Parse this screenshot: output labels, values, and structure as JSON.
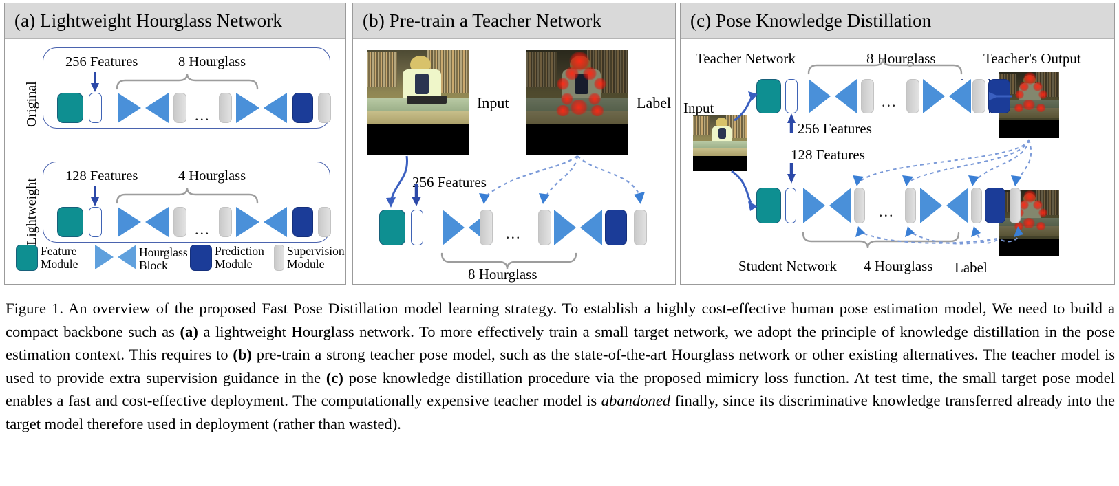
{
  "panels": [
    {
      "id": "a",
      "title": "(a) Lightweight Hourglass Network",
      "rows": [
        {
          "side_label": "Original",
          "features_label": "256 Features",
          "hourglass_label": "8 Hourglass",
          "dots": "..."
        },
        {
          "side_label": "Lightweight",
          "features_label": "128 Features",
          "hourglass_label": "4 Hourglass",
          "dots": "..."
        }
      ],
      "legend": [
        {
          "icon": "feature-module-swatch",
          "line1": "Feature",
          "line2": "Module"
        },
        {
          "icon": "hourglass-block-swatch",
          "line1": "Hourglass",
          "line2": "Block"
        },
        {
          "icon": "prediction-module-swatch",
          "line1": "Prediction",
          "line2": "Module"
        },
        {
          "icon": "supervision-module-swatch",
          "line1": "Supervision",
          "line2": "Module"
        }
      ]
    },
    {
      "id": "b",
      "title": "(b) Pre-train a Teacher Network",
      "input_label": "Input",
      "label_label": "Label",
      "features_label": "256 Features",
      "hourglass_label": "8 Hourglass",
      "dots": "..."
    },
    {
      "id": "c",
      "title": "(c) Pose Knowledge Distillation",
      "teacher_network_label": "Teacher Network",
      "teacher_hourglass_label": "8 Hourglass",
      "teacher_output_label": "Teacher's Output",
      "input_label": "Input",
      "teacher_features_label": "256 Features",
      "student_features_label": "128 Features",
      "student_network_label": "Student Network",
      "student_hourglass_label": "4 Hourglass",
      "label_label": "Label",
      "dots": "..."
    }
  ],
  "colors": {
    "feature_module": "#0e8f91",
    "hourglass_block": "#4a90d9",
    "prediction_module": "#1b3c98",
    "supervision_module": "#d0d0d0",
    "panel_header": "#d9d9d9",
    "solid_arrow": "#3a5fc0",
    "dashed_arrow": "#7b9ad8",
    "brace": "#9d9d9d",
    "rowbox_border": "#4a63ae"
  },
  "caption": {
    "prefix": "Figure 1.",
    "text_1": "   An overview of the proposed Fast Pose Distillation model learning strategy. To establish a highly cost-effective human pose estimation model, We need to build a compact backbone such as ",
    "bold_a": "(a)",
    "text_2": " a lightweight Hourglass network. To more effectively train a small target network, we adopt the principle of knowledge distillation in the pose estimation context. This requires to ",
    "bold_b": "(b)",
    "text_3": " pre-train a strong teacher pose model, such as the state-of-the-art Hourglass network or other existing alternatives. The teacher model is used to provide extra supervision guidance in the ",
    "bold_c": "(c)",
    "text_4": " pose knowledge distillation procedure via the proposed mimicry loss function. At test time, the small target pose model enables a fast and cost-effective deployment. The computationally expensive teacher model is ",
    "italic_abandoned": "abandoned",
    "text_5": " finally, since its discriminative knowledge transferred already into the target model therefore used in deployment (rather than wasted)."
  }
}
